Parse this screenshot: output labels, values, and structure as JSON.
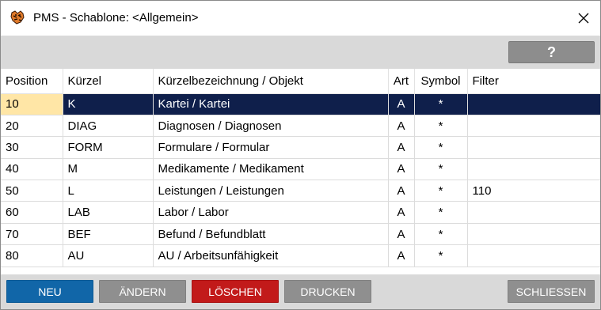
{
  "window": {
    "title": "PMS - Schablone: <Allgemein>",
    "app_icon": "pms-tiger-icon",
    "close_icon": "close-icon"
  },
  "toolbar": {
    "help_label": "?"
  },
  "table": {
    "columns": [
      "Position",
      "Kürzel",
      "Kürzelbezeichnung / Objekt",
      "Art",
      "Symbol",
      "Filter"
    ],
    "rows": [
      {
        "position": "10",
        "kuerzel": "K",
        "bezeichnung": "Kartei / Kartei",
        "art": "A",
        "symbol": "*",
        "filter": ""
      },
      {
        "position": "20",
        "kuerzel": "DIAG",
        "bezeichnung": "Diagnosen / Diagnosen",
        "art": "A",
        "symbol": "*",
        "filter": ""
      },
      {
        "position": "30",
        "kuerzel": "FORM",
        "bezeichnung": "Formulare / Formular",
        "art": "A",
        "symbol": "*",
        "filter": ""
      },
      {
        "position": "40",
        "kuerzel": "M",
        "bezeichnung": "Medikamente / Medikament",
        "art": "A",
        "symbol": "*",
        "filter": ""
      },
      {
        "position": "50",
        "kuerzel": "L",
        "bezeichnung": "Leistungen / Leistungen",
        "art": "A",
        "symbol": "*",
        "filter": "110"
      },
      {
        "position": "60",
        "kuerzel": "LAB",
        "bezeichnung": "Labor / Labor",
        "art": "A",
        "symbol": "*",
        "filter": ""
      },
      {
        "position": "70",
        "kuerzel": "BEF",
        "bezeichnung": "Befund / Befundblatt",
        "art": "A",
        "symbol": "*",
        "filter": ""
      },
      {
        "position": "80",
        "kuerzel": "AU",
        "bezeichnung": "AU / Arbeitsunfähigkeit",
        "art": "A",
        "symbol": "*",
        "filter": ""
      }
    ],
    "selected_row": 0
  },
  "buttons": {
    "neu": "NEU",
    "aendern": "ÄNDERN",
    "loeschen": "LÖSCHEN",
    "drucken": "DRUCKEN",
    "schliessen": "SCHLIESSEN"
  },
  "colors": {
    "selected_row": "#0f1f4b",
    "selected_cell": "#ffe6a6",
    "neu_button": "#1166a8",
    "loeschen_button": "#c21a1a",
    "neutral_button": "#8f8f8f"
  }
}
